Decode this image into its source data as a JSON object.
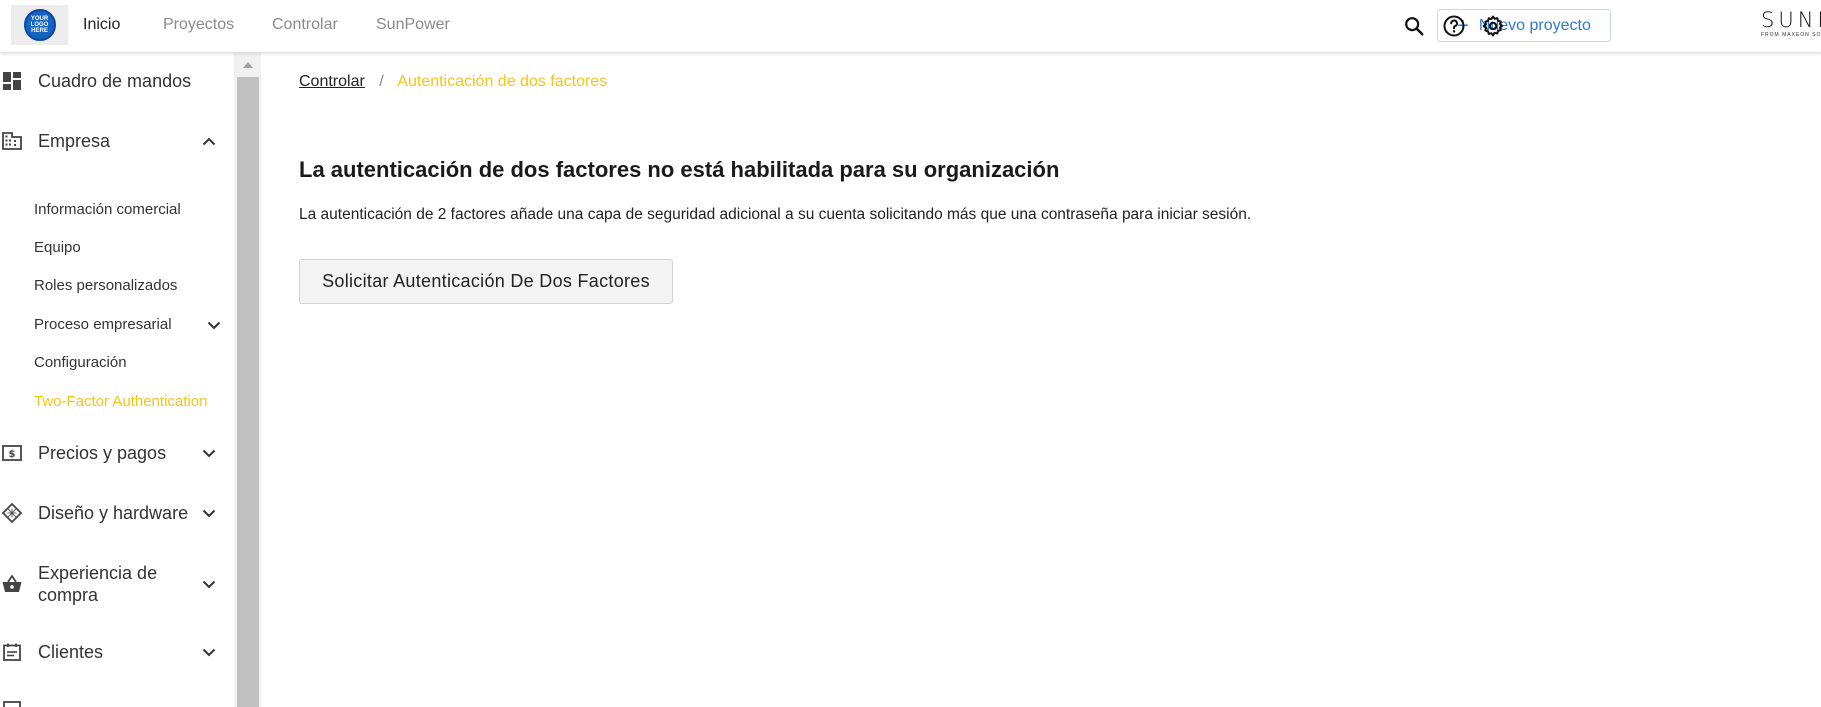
{
  "topbar": {
    "logo_text": "YOUR LOGO HERE",
    "nav": [
      {
        "label": "Inicio",
        "active": true
      },
      {
        "label": "Proyectos",
        "active": false
      },
      {
        "label": "Controlar",
        "active": false
      },
      {
        "label": "SunPower",
        "active": false
      }
    ],
    "new_project_label": "Nuevo proyecto",
    "icons": [
      "search-icon",
      "help-icon",
      "gear-icon"
    ],
    "brand_name": "SUNPOWER",
    "brand_sub": "FROM MAXEON SOLAR TECHNOLOGIES"
  },
  "sidebar": {
    "items": [
      {
        "label": "Cuadro de mandos",
        "icon": "dashboard-icon",
        "chevron": null
      },
      {
        "label": "Empresa",
        "icon": "building-icon",
        "chevron": "up"
      },
      {
        "label": "Precios y pagos",
        "icon": "money-icon",
        "chevron": "down"
      },
      {
        "label": "Diseño y hardware",
        "icon": "panel-grid-icon",
        "chevron": "down"
      },
      {
        "label": "Experiencia de compra",
        "icon": "basket-icon",
        "chevron": "down"
      },
      {
        "label": "Clientes",
        "icon": "calendar-list-icon",
        "chevron": "down"
      }
    ],
    "subitems": [
      {
        "label": "Información comercial",
        "active": false
      },
      {
        "label": "Equipo",
        "active": false
      },
      {
        "label": "Roles personalizados",
        "active": false
      },
      {
        "label": "Proceso empresarial",
        "active": false,
        "chevron": "down"
      },
      {
        "label": "Configuración",
        "active": false
      },
      {
        "label": "Two-Factor Authentication",
        "active": true
      }
    ]
  },
  "main": {
    "breadcrumb": {
      "parent": "Controlar",
      "separator": "/",
      "current": "Autenticación de dos factores"
    },
    "title": "La autenticación de dos factores no está habilitada para su organización",
    "description": "La autenticación de 2 factores añade una capa de seguridad adicional a su cuenta solicitando más que una contraseña para iniciar sesión.",
    "button_label": "Solicitar Autenticación De Dos Factores"
  },
  "colors": {
    "accent_yellow": "#f5c518",
    "link_blue": "#2f7ad0",
    "text_dark": "#222222",
    "nav_muted": "#8a8a8a"
  }
}
